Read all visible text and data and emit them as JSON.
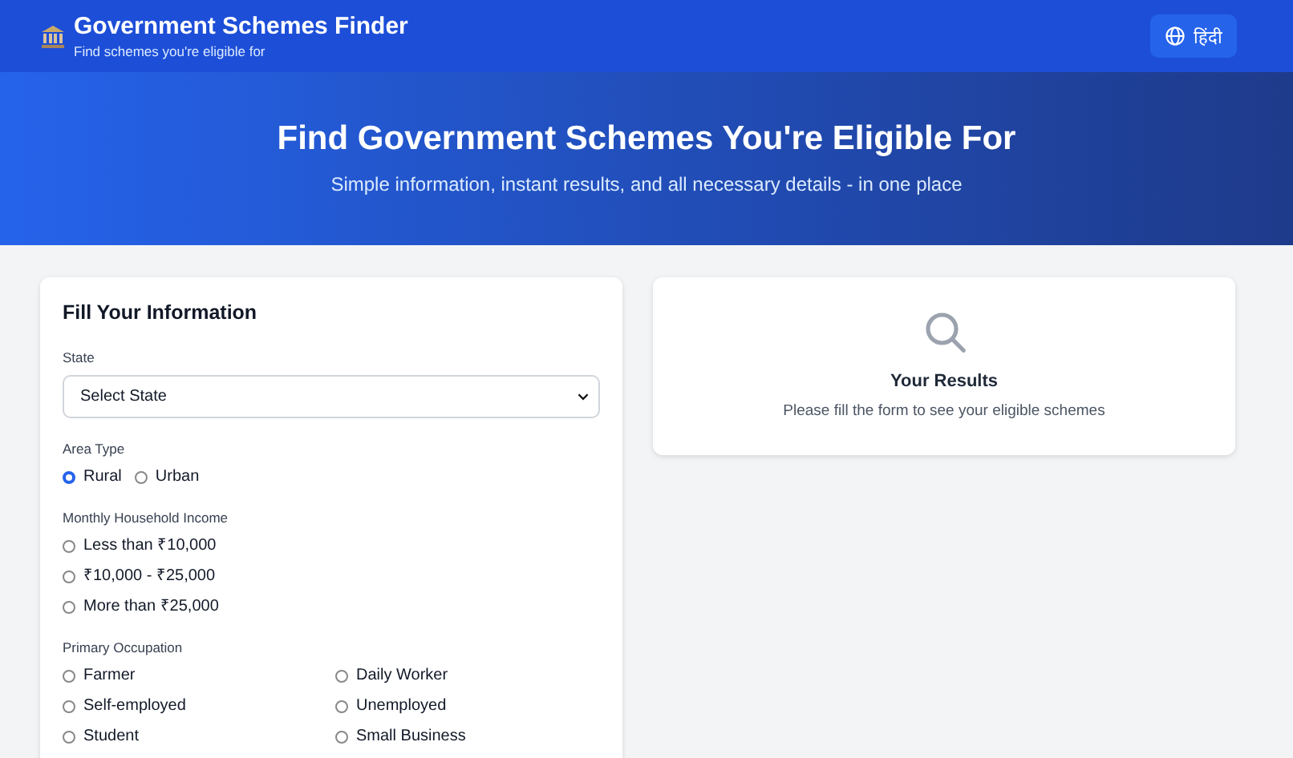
{
  "header": {
    "title": "Government Schemes Finder",
    "subtitle": "Find schemes you're eligible for",
    "language_button": "हिंदी"
  },
  "hero": {
    "title": "Find Government Schemes You're Eligible For",
    "subtitle": "Simple information, instant results, and all necessary details - in one place"
  },
  "form": {
    "title": "Fill Your Information",
    "fields": [
      {
        "kind": "select",
        "label": "State",
        "value": "Select State"
      },
      {
        "kind": "radio-inline",
        "label": "Area Type",
        "options": [
          {
            "label": "Rural",
            "selected": true
          },
          {
            "label": "Urban",
            "selected": false
          }
        ]
      },
      {
        "kind": "radio-list",
        "label": "Monthly Household Income",
        "options": [
          {
            "label": "Less than ₹10,000",
            "selected": false
          },
          {
            "label": "₹10,000 - ₹25,000",
            "selected": false
          },
          {
            "label": "More than ₹25,000",
            "selected": false
          }
        ]
      },
      {
        "kind": "radio-grid",
        "label": "Primary Occupation",
        "options": [
          {
            "label": "Farmer",
            "selected": false
          },
          {
            "label": "Daily Worker",
            "selected": false
          },
          {
            "label": "Self-employed",
            "selected": false
          },
          {
            "label": "Unemployed",
            "selected": false
          },
          {
            "label": "Student",
            "selected": false
          },
          {
            "label": "Small Business",
            "selected": false
          }
        ]
      }
    ]
  },
  "results": {
    "title": "Your Results",
    "message": "Please fill the form to see your eligible schemes"
  }
}
